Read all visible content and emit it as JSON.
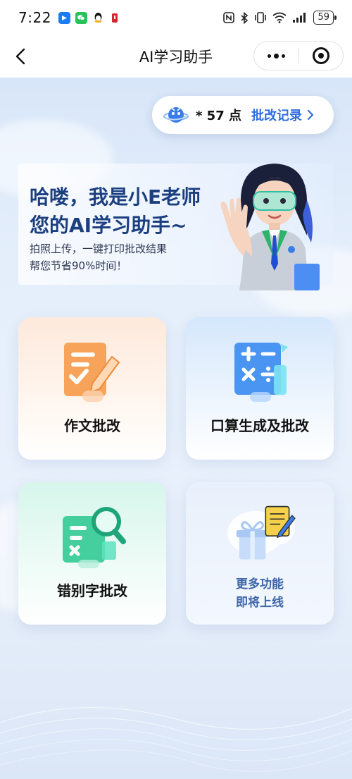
{
  "status_bar": {
    "time": "7:22",
    "battery": "59",
    "app_icons": [
      "app-blue-icon",
      "wechat-icon",
      "qq-icon",
      "notification-icon"
    ],
    "right_icons": [
      "nfc-icon",
      "bluetooth-icon",
      "vibrate-icon",
      "wifi-icon",
      "signal-icon"
    ]
  },
  "nav": {
    "title": "AI学习助手",
    "back_icon": "back-arrow-icon",
    "more_icon": "more-dots-icon",
    "close_icon": "target-circle-icon"
  },
  "points": {
    "value_text": "* 57 点",
    "record_label": "批改记录",
    "icon": "planet-icon",
    "arrow": "chevron-right-icon"
  },
  "hero": {
    "title_line1": "哈喽，我是小E老师",
    "title_line2": "您的AI学习助手~",
    "sub_line1": "拍照上传，一键打印批改结果",
    "sub_line2": "帮您节省90%时间！",
    "mascot": "teacher-avatar"
  },
  "cards": {
    "essay": {
      "label": "作文批改",
      "icon": "essay-pen-icon"
    },
    "math": {
      "label": "口算生成及批改",
      "icon": "math-symbols-icon"
    },
    "typo": {
      "label": "错别字批改",
      "icon": "magnifier-check-icon"
    },
    "more": {
      "line1": "更多功能",
      "line2": "即将上线",
      "icon": "gift-document-icon"
    }
  },
  "colors": {
    "accent_blue": "#2f6fe0",
    "hero_title": "#1c3f80",
    "more_text": "#3d66a8",
    "essay_orange": "#f59b4f",
    "math_blue": "#3b8ff0",
    "typo_green": "#3cc69a"
  }
}
